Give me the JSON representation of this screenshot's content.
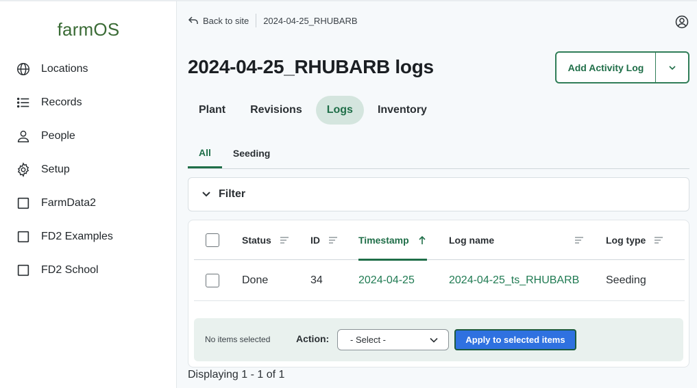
{
  "sidebar": {
    "logo": "farmOS",
    "items": [
      {
        "label": "Locations",
        "icon": "globe-icon"
      },
      {
        "label": "Records",
        "icon": "list-icon"
      },
      {
        "label": "People",
        "icon": "person-icon"
      },
      {
        "label": "Setup",
        "icon": "gear-icon"
      },
      {
        "label": "FarmData2",
        "icon": "square-icon"
      },
      {
        "label": "FD2 Examples",
        "icon": "square-icon"
      },
      {
        "label": "FD2 School",
        "icon": "square-icon"
      }
    ]
  },
  "header": {
    "back_label": "Back to site",
    "breadcrumb": "2024-04-25_RHUBARB"
  },
  "page": {
    "title": "2024-04-25_RHUBARB logs",
    "add_button": "Add Activity Log"
  },
  "tabs": [
    {
      "label": "Plant",
      "active": false
    },
    {
      "label": "Revisions",
      "active": false
    },
    {
      "label": "Logs",
      "active": true
    },
    {
      "label": "Inventory",
      "active": false
    }
  ],
  "subtabs": [
    {
      "label": "All",
      "active": true
    },
    {
      "label": "Seeding",
      "active": false
    }
  ],
  "filter": {
    "label": "Filter"
  },
  "table": {
    "columns": [
      "Status",
      "ID",
      "Timestamp",
      "Log name",
      "Log type"
    ],
    "sorted_column": "Timestamp",
    "rows": [
      {
        "status": "Done",
        "id": "34",
        "timestamp": "2024-04-25",
        "log_name": "2024-04-25_ts_RHUBARB",
        "log_type": "Seeding"
      }
    ]
  },
  "bulk": {
    "selected_text": "No items selected",
    "action_label": "Action:",
    "select_value": "- Select -",
    "apply_label": "Apply to selected items"
  },
  "footer": {
    "displaying": "Displaying 1 - 1 of 1"
  },
  "colors": {
    "brand": "#3a6b35",
    "accent": "#1f6e48",
    "apply": "#2f71e0"
  }
}
